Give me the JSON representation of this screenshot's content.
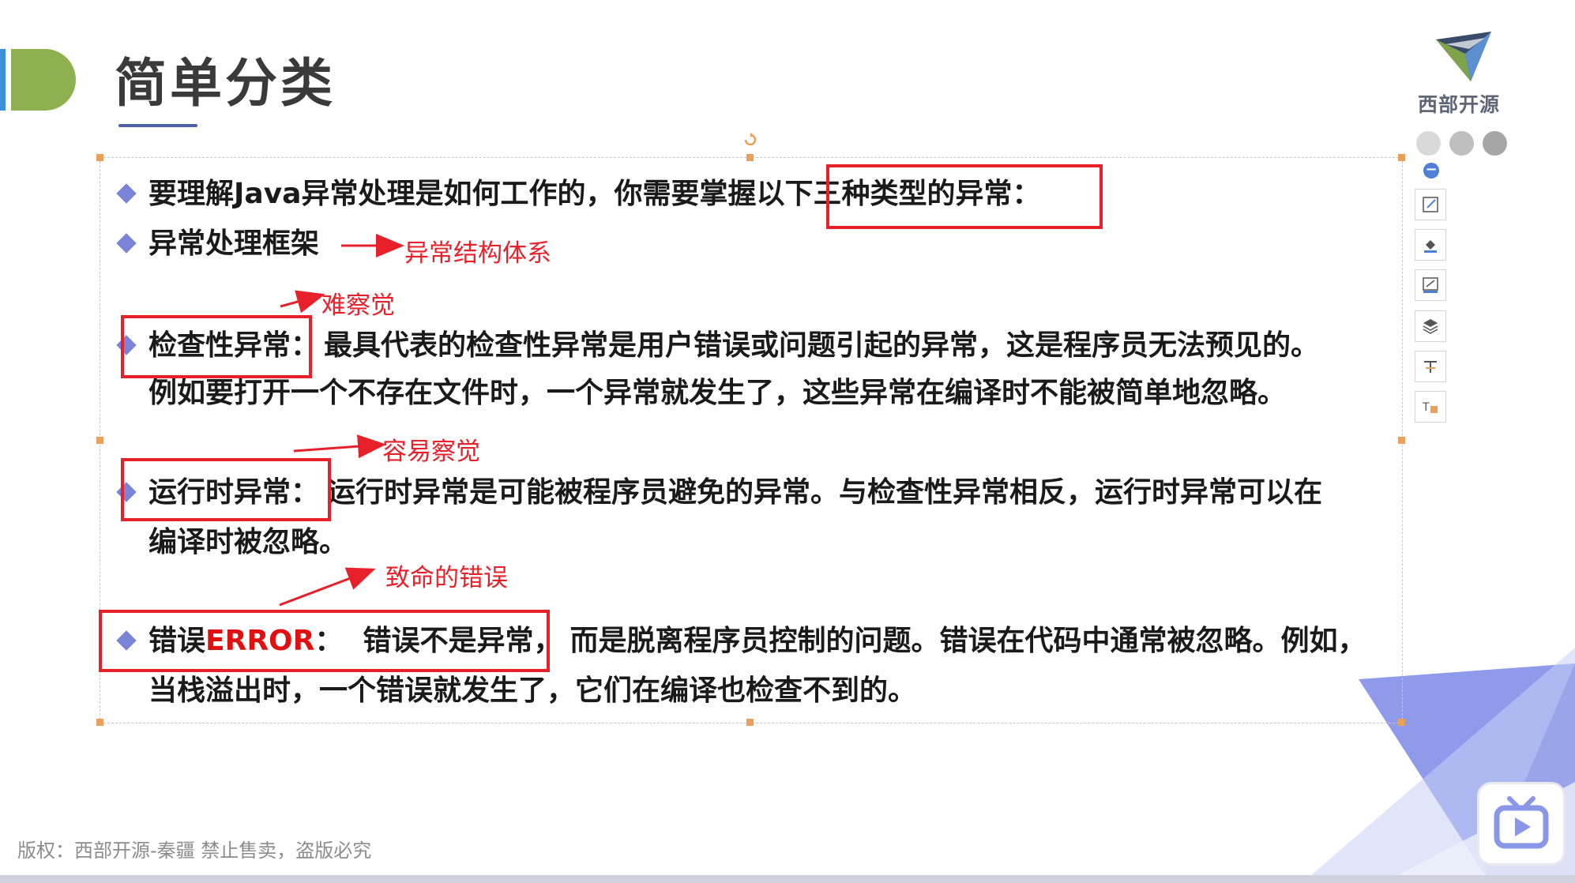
{
  "slide": {
    "title": "简单分类",
    "logo_text": "西部开源",
    "footer": "版权：西部开源-秦疆    禁止售卖，盗版必究"
  },
  "content": {
    "line1": "要理解Java异常处理是如何工作的，你需要掌握以下三种类型的异常：",
    "line2": "异常处理框架",
    "checked_label": "检查性异常：",
    "checked_text": "最具代表的检查性异常是用户错误或问题引起的异常，这是程序员无法预见的。",
    "checked_text2": "例如要打开一个不存在文件时，一个异常就发生了，这些异常在编译时不能被简单地忽略。",
    "runtime_label": "运行时异常：",
    "runtime_text": "运行时异常是可能被程序员避免的异常。与检查性异常相反，运行时异常可以在",
    "runtime_text2": "编译时被忽略。",
    "error_label_prefix": "错误",
    "error_label_word": "ERROR",
    "error_label_suffix": "：  错误不是异常，",
    "error_text": "而是脱离程序员控制的问题。错误在代码中通常被忽略。例如，",
    "error_text2": "当栈溢出时，一个错误就发生了，它们在编译也检查不到的。"
  },
  "annotations": {
    "framework": "异常结构体系",
    "checked": "难察觉",
    "runtime": "容易察觉",
    "error": "致命的错误"
  },
  "toolbar": {
    "icons": [
      "edit-shape-icon",
      "fill-icon",
      "outline-icon",
      "layers-icon",
      "text-style-icon",
      "text-box-icon"
    ]
  },
  "colors": {
    "accent_green": "#8fb04f",
    "accent_blue": "#3d8fd9",
    "annotation_red": "#e8202a",
    "bullet": "#7a84d6",
    "corner_triangle": "#6d7ee0"
  }
}
